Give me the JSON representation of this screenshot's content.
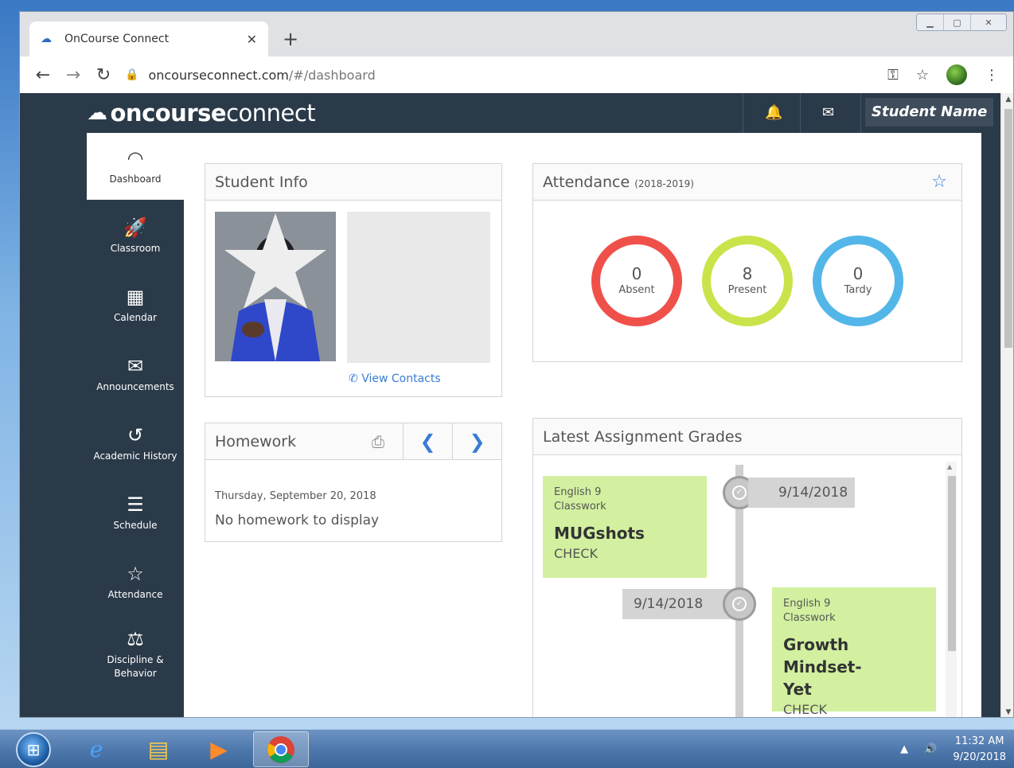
{
  "browser": {
    "tab_title": "OnCourse Connect",
    "new_tab_label": "+",
    "url_host": "oncourseconnect.com",
    "url_path": "/#/dashboard"
  },
  "app": {
    "brand_bold": "oncourse",
    "brand_light": "connect",
    "student_name": "Student Name"
  },
  "sidebar": {
    "items": [
      {
        "label": "Dashboard",
        "icon": "speedometer-icon"
      },
      {
        "label": "Classroom",
        "icon": "rocket-icon"
      },
      {
        "label": "Calendar",
        "icon": "calendar-icon"
      },
      {
        "label": "Announcements",
        "icon": "envelope-icon"
      },
      {
        "label": "Academic History",
        "icon": "history-icon"
      },
      {
        "label": "Schedule",
        "icon": "list-icon"
      },
      {
        "label": "Attendance",
        "icon": "star-icon"
      },
      {
        "label": "Discipline &",
        "label2": "Behavior",
        "icon": "scales-icon"
      }
    ]
  },
  "student_info": {
    "title": "Student Info",
    "view_contacts": "View Contacts"
  },
  "homework": {
    "title": "Homework",
    "date": "Thursday, September 20, 2018",
    "empty_message": "No homework to display"
  },
  "attendance": {
    "title": "Attendance",
    "year": "(2018-2019)",
    "stats": [
      {
        "value": "0",
        "label": "Absent",
        "color": "#f0504a"
      },
      {
        "value": "8",
        "label": "Present",
        "color": "#c8e44a"
      },
      {
        "value": "0",
        "label": "Tardy",
        "color": "#53b6e8"
      }
    ]
  },
  "grades": {
    "title": "Latest Assignment Grades",
    "items": [
      {
        "course": "English 9",
        "category": "Classwork",
        "assignment": "MUGshots",
        "grade": "CHECK",
        "date": "9/14/2018"
      },
      {
        "course": "English 9",
        "category": "Classwork",
        "assignment_line1": "Growth Mindset-",
        "assignment_line2": "Yet",
        "grade": "CHECK",
        "date": "9/14/2018"
      }
    ]
  },
  "taskbar": {
    "time": "11:32 AM",
    "date": "9/20/2018"
  },
  "colors": {
    "nav_bg": "#2b3a49",
    "accent": "#3a7bd5",
    "card_green": "#d2f0a0"
  }
}
